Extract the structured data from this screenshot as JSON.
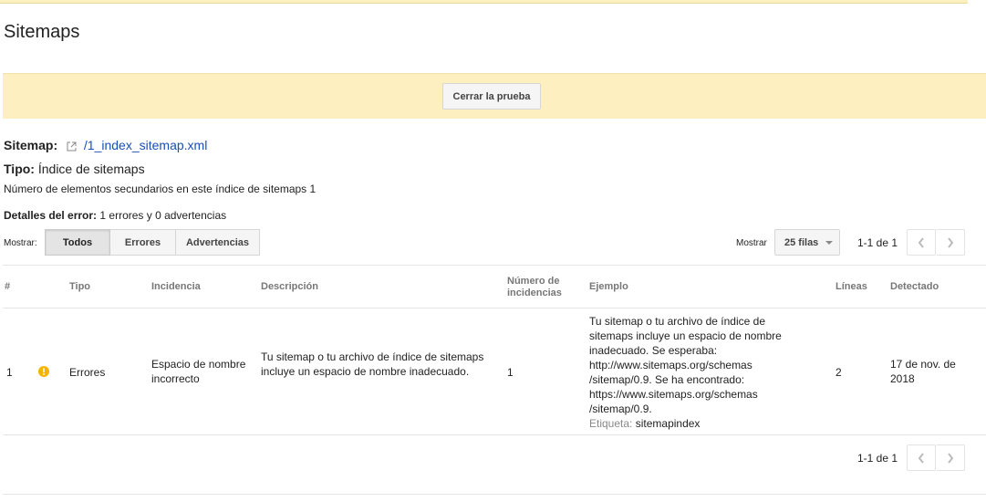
{
  "page": {
    "title": "Sitemaps"
  },
  "banner": {
    "close_test_label": "Cerrar la prueba"
  },
  "sitemap": {
    "label": "Sitemap:",
    "link_text": "/1_index_sitemap.xml",
    "type_label": "Tipo:",
    "type_value": "Índice de sitemaps",
    "children_label": "Número de elementos secundarios en este índice de sitemaps",
    "children_count": "1",
    "error_label": "Detalles del error:",
    "error_summary": "1 errores y 0 advertencias"
  },
  "filters": {
    "show_label": "Mostrar:",
    "options": [
      "Todos",
      "Errores",
      "Advertencias"
    ],
    "selected": "Todos"
  },
  "paging": {
    "rows_label": "Mostrar",
    "rows_value": "25 filas",
    "range_text": "1-1 de 1"
  },
  "table": {
    "headers": {
      "num": "#",
      "type": "Tipo",
      "issue": "Incidencia",
      "description": "Descripción",
      "count_line1": "Número de",
      "count_line2": "incidencias",
      "example": "Ejemplo",
      "lines": "Líneas",
      "detected": "Detectado"
    },
    "rows": [
      {
        "num": "1",
        "type": "Errores",
        "issue": "Espacio de nombre incorrecto",
        "description": "Tu sitemap o tu archivo de índice de sitemaps incluye un espacio de nombre inadecuado.",
        "count": "1",
        "example": "Tu sitemap o tu archivo de índice de sitemaps incluye un espacio de nombre inadecuado. Se esperaba: http://www.sitemaps.org/schemas /sitemap/0.9. Se ha encontrado: https://www.sitemaps.org/schemas /sitemap/0.9.",
        "tag_label": "Etiqueta:",
        "tag_value": "sitemapindex",
        "lines": "2",
        "detected": "17 de nov. de 2018"
      }
    ]
  },
  "colors": {
    "banner_bg": "#fdefbf",
    "link": "#1a4fb5",
    "warning_icon": "#f4b400"
  }
}
